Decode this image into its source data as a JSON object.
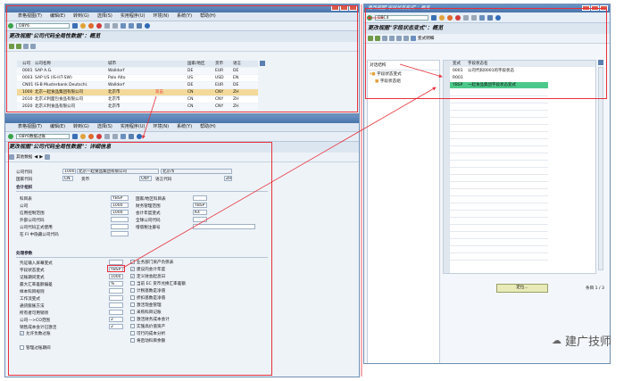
{
  "sap_menu": [
    "表格视图(T)",
    "编辑(E)",
    "转到(G)",
    "选择(S)",
    "实用程序(U)",
    "环境(N)",
    "系统(Y)",
    "帮助(H)"
  ],
  "win1": {
    "command": "OBY6",
    "title": "更改视图\"公司代码全局性数据\"：概览",
    "columns": [
      "公司",
      "公司名称",
      "城市",
      "国家/地区",
      "货币",
      "语言"
    ],
    "rows": [
      [
        "0001",
        "SAP A.G.",
        "Walldorf",
        "DE",
        "EUR",
        "DE"
      ],
      [
        "0003",
        "SAP US (IS-HT-SW)",
        "Palo Alto",
        "US",
        "USD",
        "EN"
      ],
      [
        "CN01",
        "IS-B Musterbank Deutschl.",
        "Walldorf",
        "DE",
        "EUR",
        "DE"
      ],
      [
        "1000",
        "北京一起食品集团有限公司",
        "北京市",
        "CN",
        "CNY",
        "ZH"
      ],
      [
        "2010",
        "北京义利面包食品有限公司",
        "北京市",
        "CN",
        "CNY",
        "ZH"
      ],
      [
        "2020",
        "北京义利食品有限公司",
        "北京市",
        "CN",
        "CNY",
        "ZH"
      ]
    ],
    "double_click_note": "双击"
  },
  "win2": {
    "command": "OBY6数据过账",
    "title": "更改视图\"公司代码全局性数据\"：详细信息",
    "app_toolbar": "其他数据",
    "company_code_label": "公司代码",
    "company_code": "1000",
    "company_name": "北京一起食品集团有限公司",
    "city": "北京市",
    "country_label": "国家代码",
    "country": "CN",
    "currency_label": "货币",
    "currency": "CNY",
    "language_label": "语言代码",
    "language": "ZH",
    "section_account": "会计组织",
    "section_process": "处理参数",
    "left_labels_1": [
      "科目表",
      "公司",
      "信用控制范围",
      "外部公司代码",
      "公司代码正式使用",
      "在 FI 中隐藏公司代码"
    ],
    "left_values_1": [
      "YBSP",
      "1000",
      "1000",
      "",
      "",
      ""
    ],
    "mid_labels_1": [
      "国家/地区科目表",
      "财务管理范围",
      "会计年度变式",
      "全球公司代码",
      "增值税注册号"
    ],
    "mid_values_1": [
      "",
      "YBSP",
      "K4",
      "",
      ""
    ],
    "left_labels_2": [
      "凭证输入屏幕变式",
      "字段状态变式",
      "记账期间变式",
      "最大汇率差额偏差",
      "样本科目规则",
      "工作流变式",
      "通货膨胀方法",
      "所有者可用销项",
      "公司--->CO范围",
      "销售成本会计已激活",
      "允许负数过账",
      "管理过账期间"
    ],
    "left_values_2": [
      "",
      "YBSP",
      "1000",
      "%",
      "",
      "",
      "",
      "",
      "2",
      "2",
      "",
      ""
    ],
    "right_labels_2": [
      "业务部门资产负债表",
      "建议的会计年度",
      "定义财会起息日",
      "当前 EC 货币兑换汇率差额",
      "计税基数是净值",
      "折扣基数是净值",
      "激活现金管理",
      "采购科目记账",
      "激活财务成本会计",
      "实施高价值资产",
      "可行的成本分析",
      "将启动科目余额"
    ],
    "right_checked_2": [
      false,
      true,
      true,
      false,
      false,
      false,
      false,
      false,
      false,
      false,
      false,
      false
    ],
    "fld_status_value": "YBSP"
  },
  "win3": {
    "command": "OBC4",
    "title_bar": "更改视图\"字段状态变式\"：概览",
    "title": "更改视图\"字段状态变式\"：概览",
    "app_toolbar": "变式明细",
    "tree_root": "对话结构",
    "tree_item_1": "字段状态变式",
    "tree_item_2": "字段状态组",
    "columns": [
      "变式",
      "字段状态名"
    ],
    "rows": [
      [
        "0001",
        "公司代码0001的字段状态"
      ],
      [
        "R001",
        ""
      ],
      [
        "YBSP",
        "一起食品集团字段状态变式"
      ]
    ],
    "position_button": "定位...",
    "entry_text": "条目 1 / 3"
  },
  "watermark": "建广技师",
  "colors": {
    "sap_blue": "#4a74aa",
    "red_box": "#e8303a",
    "highlight_row": "#f3d99a",
    "selected_row": "#4cc98a"
  }
}
